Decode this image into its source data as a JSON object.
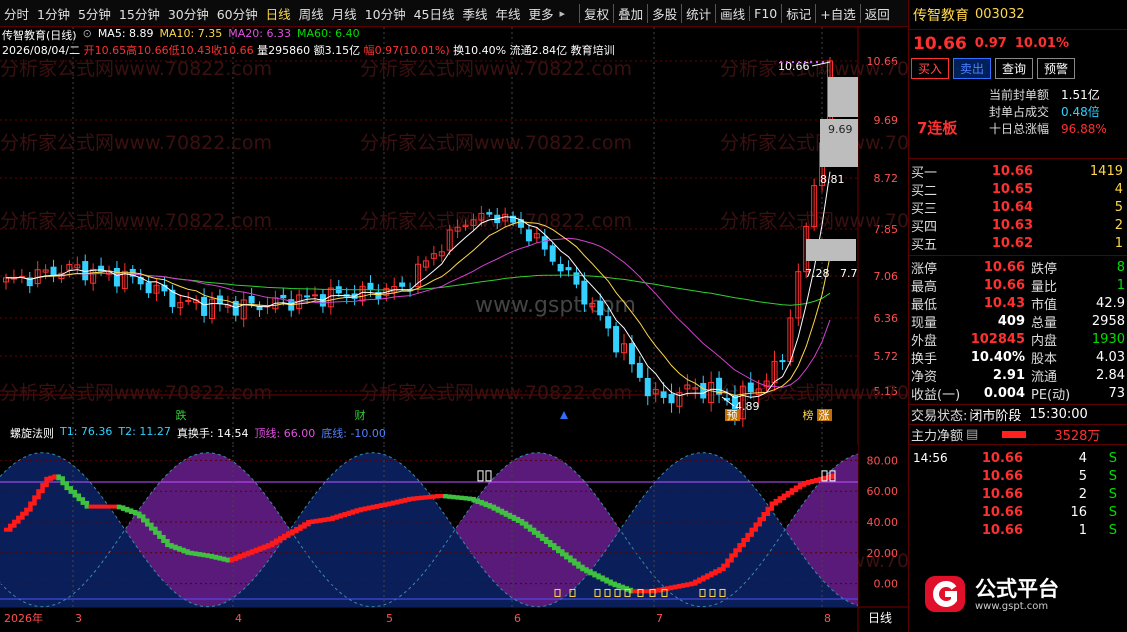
{
  "toolbar": {
    "items": [
      "分时",
      "1分钟",
      "5分钟",
      "15分钟",
      "30分钟",
      "60分钟",
      "日线",
      "周线",
      "月线",
      "10分钟",
      "45日线",
      "季线",
      "年线",
      "更多"
    ],
    "items2": [
      "复权",
      "叠加",
      "多股",
      "统计",
      "画线",
      "F10",
      "标记",
      "+自选",
      "返回"
    ]
  },
  "chart_header": {
    "name": "传智教育(日线)",
    "ma5": "MA5: 8.89",
    "ma10": "MA10: 7.35",
    "ma20": "MA20: 6.33",
    "ma60": "MA60: 6.40"
  },
  "info": {
    "date": "2026/08/04/二",
    "open": "开10.65",
    "high": "高10.66",
    "low": "低10.43",
    "close": "收10.66",
    "vol": "量295860",
    "amt": "额3.15亿",
    "pct": "幅0.97(10.01%)",
    "turnover": "换10.40%",
    "float": "流通2.84亿",
    "sector": "教育培训"
  },
  "watermark": "分析家公式网www.70822.com",
  "watermark2": "www.gspt.com",
  "price_axis": [
    "10.66",
    "9.69",
    "8.72",
    "7.85",
    "7.06",
    "6.36",
    "5.72",
    "5.15"
  ],
  "annotations": {
    "top": "10.66",
    "low": "4.89",
    "mid1": "9.69",
    "mid2": "8.81",
    "mid3": "7.28",
    "mid4": "7.7",
    "tag_die": "跌",
    "tag_cai": "财",
    "tag_yu": "预",
    "tag_bang": "榜",
    "tag_zhang": "涨"
  },
  "indicator": {
    "name": "螺旋法则",
    "t1": "T1: 76.36",
    "t2": "T2: 11.27",
    "real": "真换手: 14.54",
    "top": "顶线: 66.00",
    "bottom": "底线: -10.00",
    "axis": [
      "80.00",
      "60.00",
      "40.00",
      "20.00",
      "0.00"
    ]
  },
  "date_axis": [
    "2026年",
    "3",
    "4",
    "5",
    "6",
    "7",
    "8"
  ],
  "period_label": "日线",
  "right": {
    "name": "传智教育",
    "code": "003032",
    "price": "10.66",
    "change": "0.97",
    "pct": "10.01%",
    "btn_buy": "买入",
    "btn_sell": "卖出",
    "btn_query": "查询",
    "btn_warn": "预警",
    "limit": "7连板",
    "seal_amt_lbl": "当前封单额",
    "seal_amt": "1.51亿",
    "seal_ratio_lbl": "封单占成交",
    "seal_ratio": "0.48倍",
    "ten_day_lbl": "十日总涨幅",
    "ten_day": "96.88%",
    "orderbook": [
      {
        "lbl": "买一",
        "price": "10.66",
        "vol": "1419"
      },
      {
        "lbl": "买二",
        "price": "10.65",
        "vol": "4"
      },
      {
        "lbl": "买三",
        "price": "10.64",
        "vol": "5"
      },
      {
        "lbl": "买四",
        "price": "10.63",
        "vol": "2"
      },
      {
        "lbl": "买五",
        "price": "10.62",
        "vol": "1"
      }
    ],
    "stats": [
      {
        "l1": "涨停",
        "v1": "10.66",
        "l2": "跌停",
        "v2": "8"
      },
      {
        "l1": "最高",
        "v1": "10.66",
        "l2": "量比",
        "v2": "1"
      },
      {
        "l1": "最低",
        "v1": "10.43",
        "l2": "市值",
        "v2": "42.9"
      },
      {
        "l1": "现量",
        "v1": "409",
        "l2": "总量",
        "v2": "2958"
      },
      {
        "l1": "外盘",
        "v1": "102845",
        "l2": "内盘",
        "v2": "1930"
      },
      {
        "l1": "换手",
        "v1": "10.40%",
        "l2": "股本",
        "v2": "4.03"
      },
      {
        "l1": "净资",
        "v1": "2.91",
        "l2": "流通",
        "v2": "2.84"
      },
      {
        "l1": "收益(一)",
        "v1": "0.004",
        "l2": "PE(动)",
        "v2": "73"
      }
    ],
    "status_lbl": "交易状态:",
    "status": "闭市阶段",
    "status_time": "15:30:00",
    "main_flow_lbl": "主力净额",
    "main_flow": "3528万",
    "ticks": [
      {
        "time": "14:56",
        "price": "10.66",
        "vol": "4",
        "dir": "S"
      },
      {
        "time": "",
        "price": "10.66",
        "vol": "5",
        "dir": "S"
      },
      {
        "time": "",
        "price": "10.66",
        "vol": "2",
        "dir": "S"
      },
      {
        "time": "",
        "price": "10.66",
        "vol": "16",
        "dir": "S"
      },
      {
        "time": "",
        "price": "10.66",
        "vol": "1",
        "dir": "S"
      }
    ],
    "logo_text": "公式平台",
    "logo_url": "www.gspt.com"
  }
}
